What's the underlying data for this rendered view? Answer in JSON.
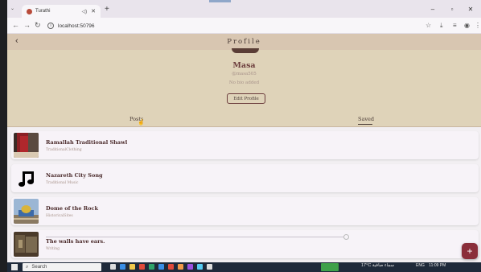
{
  "browser": {
    "tab_title": "Turathi",
    "url": "localhost:50796"
  },
  "app": {
    "title": "Profile",
    "back_icon": "back-arrow-icon",
    "user": {
      "name": "Masa",
      "handle": "@masa505",
      "bio": "No bio added"
    },
    "edit_button": "Edit Profile",
    "tabs": [
      "Posts",
      "Saved"
    ],
    "active_tab": "Saved",
    "items": [
      {
        "title": "Ramallah Traditional Shawl",
        "subtitle": "TraditionalClothing"
      },
      {
        "title": "Nazareth City Song",
        "subtitle": "Traditional Music"
      },
      {
        "title": "Dome of the Rock",
        "subtitle": "HistoricalSites"
      },
      {
        "title": "The walls have ears.",
        "subtitle": "Writing"
      }
    ],
    "fab_label": "+"
  },
  "taskbar": {
    "search_placeholder": "Search",
    "weather": "17°C سماء صافية",
    "lang": "ENG",
    "time": "11:09 PM"
  },
  "colors": {
    "header": "#d8c6b1",
    "profile_bg": "#dfd3b9",
    "accent": "#8a2e3a",
    "name": "#6b3c3c"
  }
}
